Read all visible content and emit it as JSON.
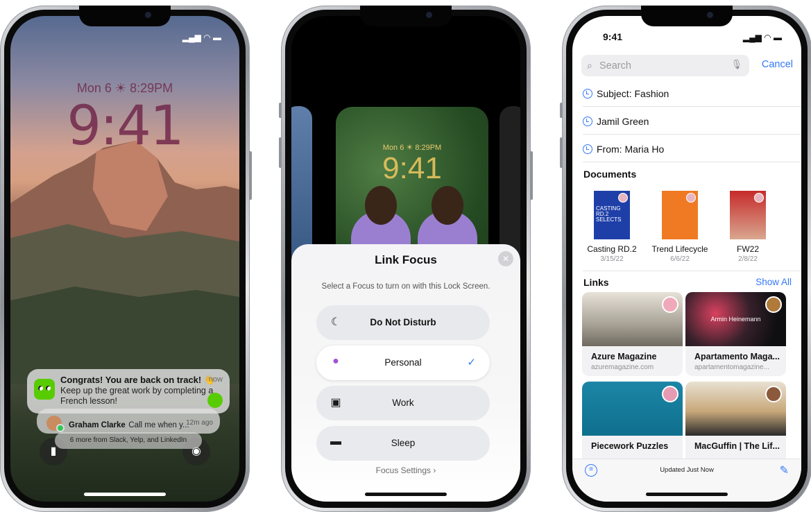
{
  "phone1": {
    "date": "Mon 6",
    "weather_time": "8:29PM",
    "time": "9:41",
    "notification_main": {
      "title": "Congrats! You are back on track! 👋",
      "body": "Keep up the great work by completing a French lesson!",
      "time": "now",
      "app_icon": "duolingo-icon"
    },
    "notification_second": {
      "sender": "Graham Clarke",
      "message": "Call me when y...",
      "time": "12m ago"
    },
    "notification_third": {
      "text": "6 more from Slack, Yelp, and LinkedIn"
    },
    "flashlight_icon": "flashlight-icon",
    "camera_icon": "camera-icon"
  },
  "phone2": {
    "preview_date": "Mon 6",
    "preview_weather_time": "8:29PM",
    "preview_time": "9:41",
    "sheet_title": "Link Focus",
    "sheet_subtitle": "Select a Focus to turn on with this Lock Screen.",
    "options": [
      {
        "label": "Do Not Disturb",
        "icon": "moon-icon",
        "selected": false
      },
      {
        "label": "Personal",
        "icon": "person-icon",
        "selected": true
      },
      {
        "label": "Work",
        "icon": "badge-icon",
        "selected": false
      },
      {
        "label": "Sleep",
        "icon": "bed-icon",
        "selected": false
      }
    ],
    "focus_settings": "Focus Settings"
  },
  "phone3": {
    "status_time": "9:41",
    "search_placeholder": "Search",
    "cancel": "Cancel",
    "recents": [
      "Subject: Fashion",
      "Jamil Green",
      "From: Maria Ho"
    ],
    "documents_header": "Documents",
    "documents": [
      {
        "title": "Casting RD.2",
        "date": "3/15/22",
        "thumb_text": "CASTING RD.2 SELECTS"
      },
      {
        "title": "Trend Lifecycle",
        "date": "6/6/22"
      },
      {
        "title": "FW22",
        "date": "2/8/22"
      }
    ],
    "links_header": "Links",
    "show_all": "Show All",
    "links": [
      {
        "title": "Azure Magazine",
        "url": "azuremagazine.com"
      },
      {
        "title": "Apartamento Maga...",
        "url": "apartamentomagazine...",
        "overlay": "Armin Heinemann"
      },
      {
        "title": "Piecework Puzzles",
        "url": ""
      },
      {
        "title": "MacGuffin | The Lif...",
        "url": ""
      }
    ],
    "updated": "Updated Just Now"
  },
  "colors": {
    "accent_blue": "#3478f6",
    "personal_purple": "#a154d6",
    "duolingo_green": "#58cc02"
  }
}
